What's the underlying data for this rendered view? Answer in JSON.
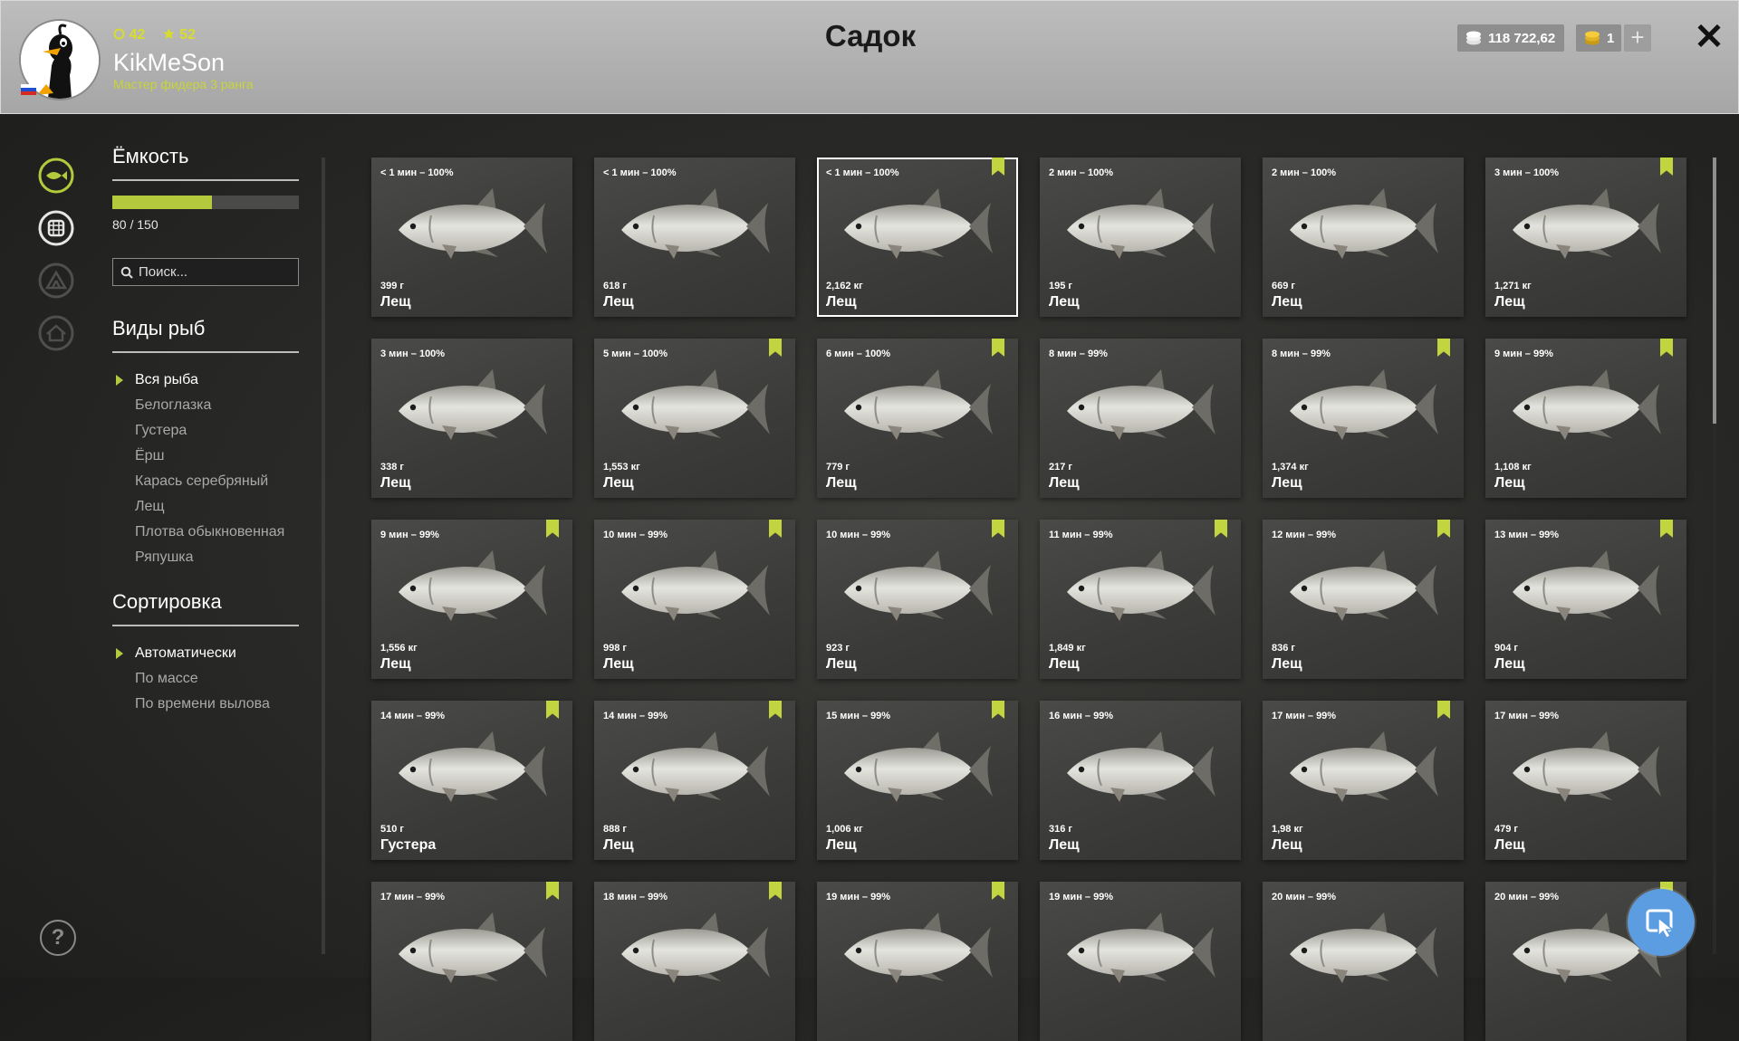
{
  "header": {
    "title": "Садок",
    "level": "42",
    "stars": "52",
    "username": "KikMeSon",
    "rank": "Мастер фидера 3 ранга",
    "money": "118 722,62",
    "gold": "1",
    "plus_label": "+",
    "close_label": "✕"
  },
  "panel": {
    "capacity_title": "Ёмкость",
    "capacity_text": "80 / 150",
    "capacity_fraction": 0.533,
    "search_placeholder": "Поиск...",
    "species_title": "Виды рыб",
    "species": [
      "Вся рыба",
      "Белоглазка",
      "Густера",
      "Ёрш",
      "Карась серебряный",
      "Лещ",
      "Плотва обыкновенная",
      "Ряпушка"
    ],
    "sort_title": "Сортировка",
    "sort_options": [
      "Автоматически",
      "По массе",
      "По времени вылова"
    ]
  },
  "fish_cards": [
    {
      "time": "< 1 мин – 100%",
      "weight": "399 г",
      "name": "Лещ",
      "bookmark": false
    },
    {
      "time": "< 1 мин – 100%",
      "weight": "618 г",
      "name": "Лещ",
      "bookmark": false
    },
    {
      "time": "< 1 мин – 100%",
      "weight": "2,162 кг",
      "name": "Лещ",
      "bookmark": true,
      "selected": true
    },
    {
      "time": "2 мин – 100%",
      "weight": "195 г",
      "name": "Лещ",
      "bookmark": false
    },
    {
      "time": "2 мин – 100%",
      "weight": "669 г",
      "name": "Лещ",
      "bookmark": false
    },
    {
      "time": "3 мин – 100%",
      "weight": "1,271 кг",
      "name": "Лещ",
      "bookmark": true
    },
    {
      "time": "3 мин – 100%",
      "weight": "338 г",
      "name": "Лещ",
      "bookmark": false
    },
    {
      "time": "5 мин – 100%",
      "weight": "1,553 кг",
      "name": "Лещ",
      "bookmark": true
    },
    {
      "time": "6 мин – 100%",
      "weight": "779 г",
      "name": "Лещ",
      "bookmark": true
    },
    {
      "time": "8 мин – 99%",
      "weight": "217 г",
      "name": "Лещ",
      "bookmark": false
    },
    {
      "time": "8 мин – 99%",
      "weight": "1,374 кг",
      "name": "Лещ",
      "bookmark": true
    },
    {
      "time": "9 мин – 99%",
      "weight": "1,108 кг",
      "name": "Лещ",
      "bookmark": true
    },
    {
      "time": "9 мин – 99%",
      "weight": "1,556 кг",
      "name": "Лещ",
      "bookmark": true
    },
    {
      "time": "10 мин – 99%",
      "weight": "998 г",
      "name": "Лещ",
      "bookmark": true
    },
    {
      "time": "10 мин – 99%",
      "weight": "923 г",
      "name": "Лещ",
      "bookmark": true
    },
    {
      "time": "11 мин – 99%",
      "weight": "1,849 кг",
      "name": "Лещ",
      "bookmark": true
    },
    {
      "time": "12 мин – 99%",
      "weight": "836 г",
      "name": "Лещ",
      "bookmark": true
    },
    {
      "time": "13 мин – 99%",
      "weight": "904 г",
      "name": "Лещ",
      "bookmark": true
    },
    {
      "time": "14 мин – 99%",
      "weight": "510 г",
      "name": "Густера",
      "bookmark": true
    },
    {
      "time": "14 мин – 99%",
      "weight": "888 г",
      "name": "Лещ",
      "bookmark": true
    },
    {
      "time": "15 мин – 99%",
      "weight": "1,006 кг",
      "name": "Лещ",
      "bookmark": true
    },
    {
      "time": "16 мин – 99%",
      "weight": "316 г",
      "name": "Лещ",
      "bookmark": false
    },
    {
      "time": "17 мин – 99%",
      "weight": "1,98 кг",
      "name": "Лещ",
      "bookmark": true
    },
    {
      "time": "17 мин – 99%",
      "weight": "479 г",
      "name": "Лещ",
      "bookmark": false
    },
    {
      "time": "17 мин – 99%",
      "weight": "",
      "name": "",
      "bookmark": true
    },
    {
      "time": "18 мин – 99%",
      "weight": "",
      "name": "",
      "bookmark": true
    },
    {
      "time": "19 мин – 99%",
      "weight": "",
      "name": "",
      "bookmark": true
    },
    {
      "time": "19 мин – 99%",
      "weight": "",
      "name": "",
      "bookmark": false
    },
    {
      "time": "20 мин – 99%",
      "weight": "",
      "name": "",
      "bookmark": false
    },
    {
      "time": "20 мин – 99%",
      "weight": "",
      "name": "",
      "bookmark": true
    }
  ],
  "help_label": "?",
  "icons": {
    "accent": "#b4c93c",
    "rail": [
      "fish-icon",
      "keepnet-icon",
      "tent-icon",
      "home-icon"
    ],
    "float_button": "cursor-window-icon"
  }
}
